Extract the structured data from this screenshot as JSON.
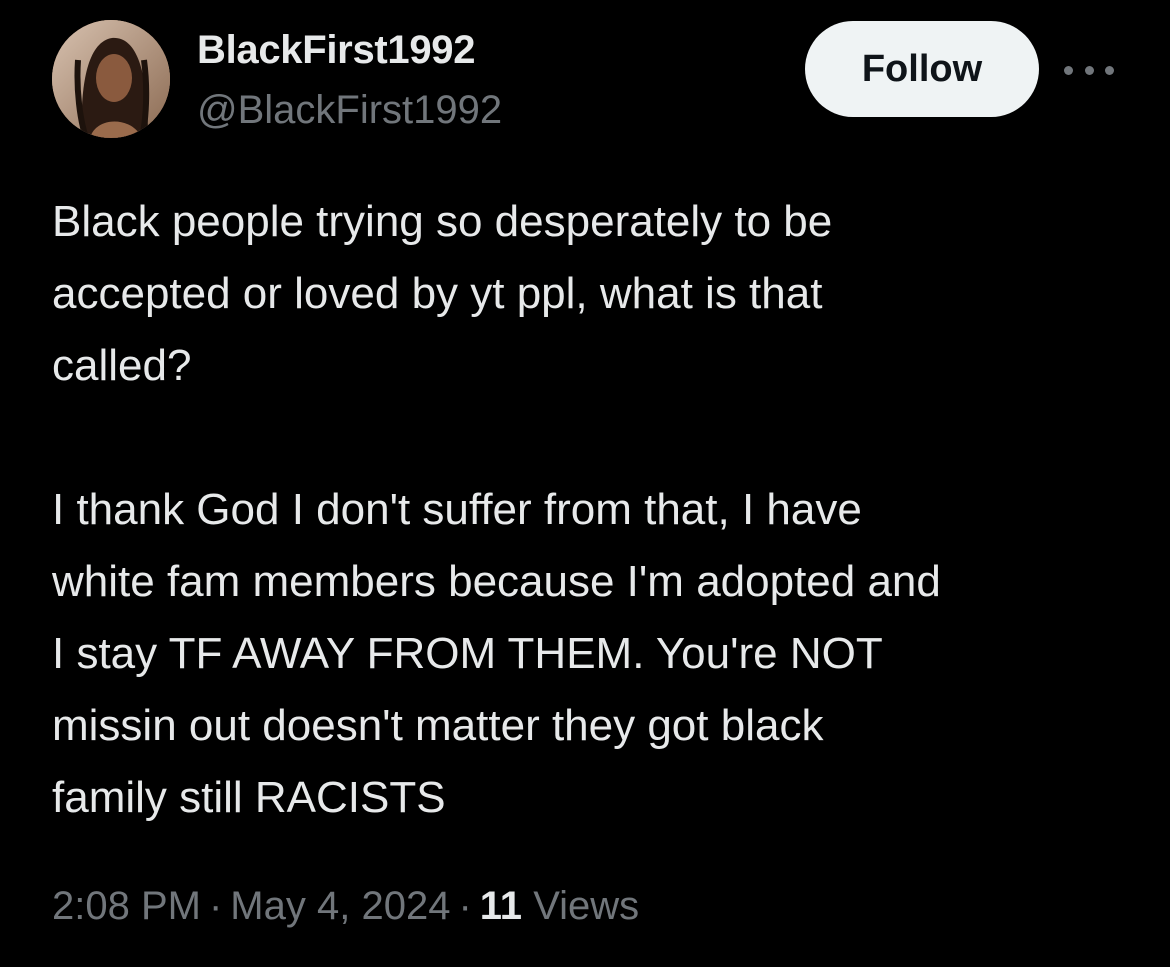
{
  "author": {
    "display_name": "BlackFirst1992",
    "handle": "@BlackFirst1992"
  },
  "actions": {
    "follow_label": "Follow",
    "more_icon": "more-horizontal-icon"
  },
  "tweet": {
    "paragraph_1": "Black people trying so desperately to be\naccepted or loved by yt ppl, what is that\ncalled?",
    "paragraph_2": "I thank God I don't suffer from that, I have\nwhite fam members because I'm adopted and\nI stay TF AWAY FROM THEM. You're NOT\nmissin out doesn't matter they got black\nfamily still RACISTS"
  },
  "meta": {
    "time": "2:08 PM",
    "separator": "·",
    "date": "May 4, 2024",
    "views_count": "11",
    "views_label": "Views"
  },
  "colors": {
    "background": "#000000",
    "primary_text": "#e7e9ea",
    "secondary_text": "#71767b",
    "follow_button_bg": "#eff3f4",
    "follow_button_text": "#0f1419"
  }
}
